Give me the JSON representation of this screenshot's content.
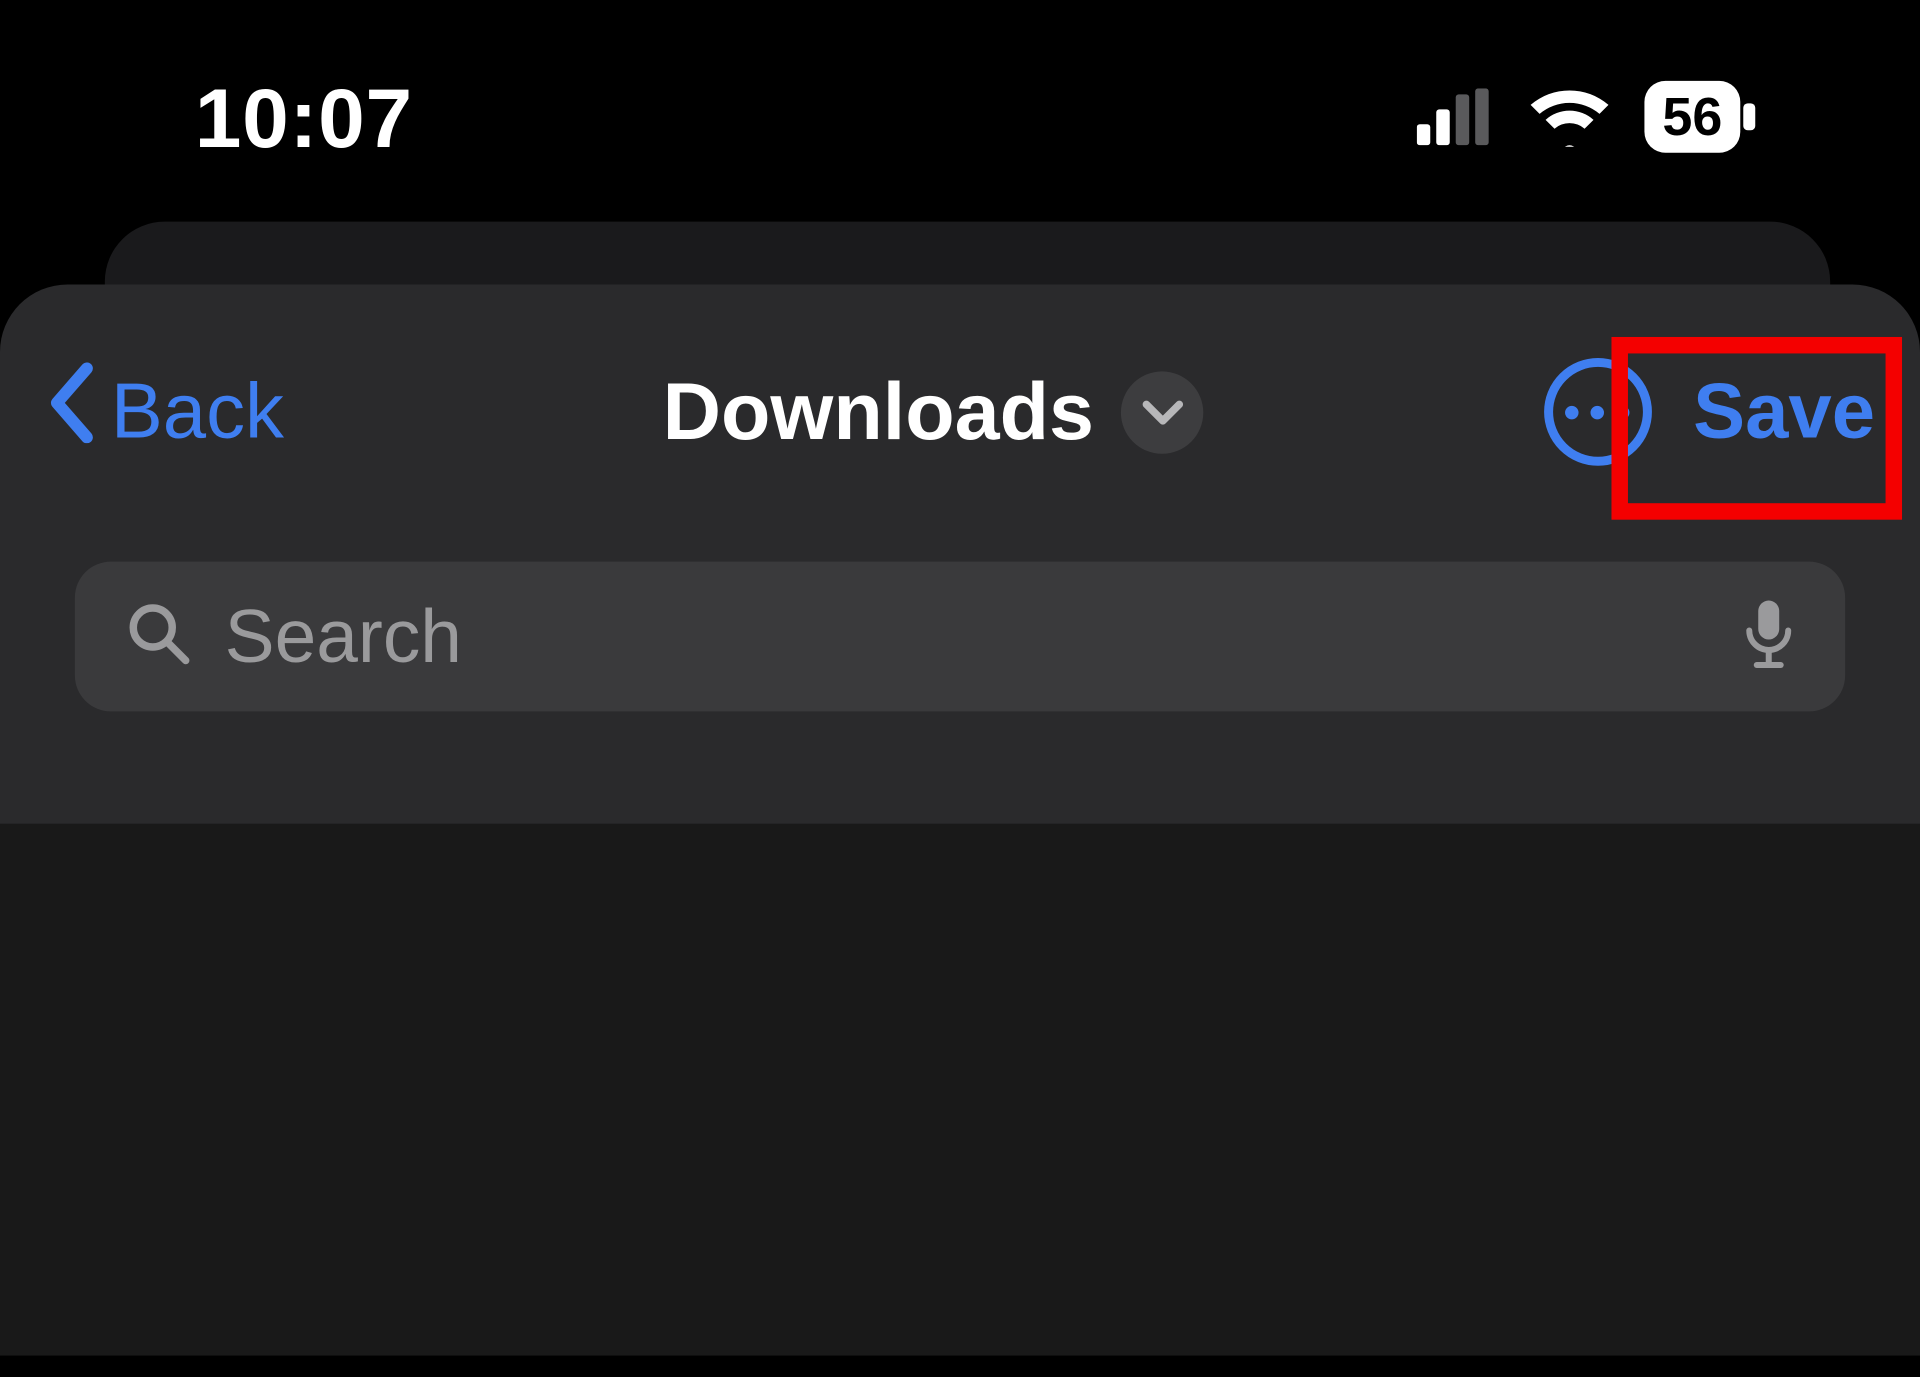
{
  "status_bar": {
    "time": "10:07",
    "battery_percent": "56"
  },
  "nav": {
    "back_label": "Back",
    "title": "Downloads",
    "save_label": "Save"
  },
  "search": {
    "placeholder": "Search"
  },
  "colors": {
    "accent": "#3f7ef0",
    "highlight": "#f40000"
  }
}
